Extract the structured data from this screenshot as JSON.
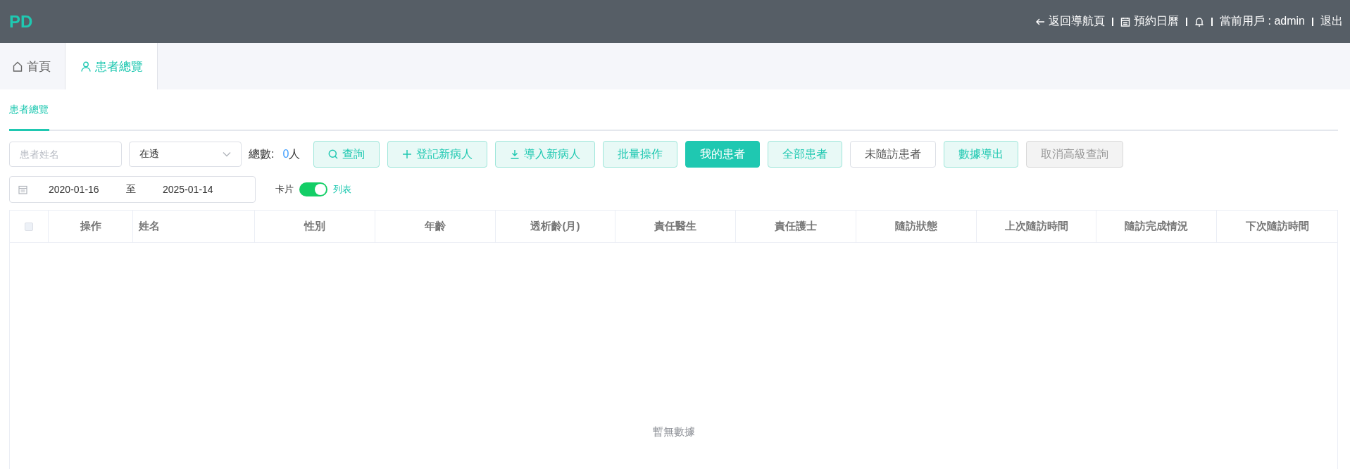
{
  "header": {
    "logo": "PD",
    "links": [
      {
        "kind": "back",
        "label": "返回導航頁"
      },
      {
        "kind": "calendar",
        "label": "預約日曆"
      },
      {
        "kind": "bell"
      },
      {
        "kind": "user",
        "label": "當前用戶 : admin"
      },
      {
        "kind": "text",
        "label": "退出"
      }
    ]
  },
  "tabs": [
    {
      "kind": "home",
      "label": "首頁",
      "selected": false
    },
    {
      "kind": "user",
      "label": "患者總覽",
      "selected": true
    }
  ],
  "subtabs": [
    {
      "label": "患者總覽",
      "selected": true
    }
  ],
  "filters": {
    "name_field": {
      "placeholder": "患者姓名"
    },
    "status_select": {
      "value": "在透"
    },
    "total": {
      "label": "總數:",
      "count": "0",
      "unit": "人"
    },
    "buttons": [
      {
        "kind": "light",
        "label": "查詢"
      },
      {
        "kind": "light",
        "label": "登記新病人"
      },
      {
        "kind": "light",
        "label": "導入新病人"
      },
      {
        "kind": "light",
        "label": "批量操作"
      },
      {
        "kind": "primary",
        "label": "我的患者"
      },
      {
        "kind": "light",
        "label": "全部患者"
      },
      {
        "kind": "default",
        "label": "未隨訪患者"
      },
      {
        "kind": "light",
        "label": "數據導出"
      },
      {
        "kind": "disabled",
        "label": "取消高級查詢"
      }
    ],
    "date_range": {
      "start": "2020-01-16",
      "separator": "至",
      "end": "2025-01-14"
    },
    "view_switch": {
      "off_label": "卡片",
      "on_label": "列表",
      "on": true
    }
  },
  "table": {
    "select_all": {
      "checked": false
    },
    "columns": [
      "操作",
      "姓名",
      "性別",
      "年齡",
      "透析齡(月)",
      "責任醫生",
      "責任護士",
      "隨訪狀態",
      "上次隨訪時間",
      "隨訪完成情況",
      "下次隨訪時間"
    ],
    "empty_text": "暫無數據"
  }
}
